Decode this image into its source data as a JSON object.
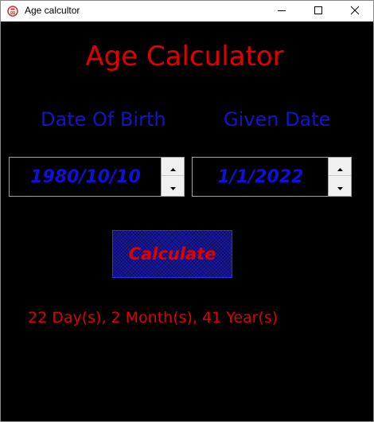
{
  "window": {
    "title": "Age calcultor",
    "icon": "calculator-app-icon",
    "controls": [
      "minimize-icon",
      "maximize-icon",
      "close-icon"
    ]
  },
  "app": {
    "heading": "Age Calculator",
    "dob_label": "Date Of Birth",
    "given_label": "Given Date",
    "dob_value": "1980/10/10",
    "given_value": "1/1/2022",
    "calculate_label": "Calculate",
    "result": "22 Day(s), 2 Month(s), 41 Year(s)"
  },
  "colors": {
    "background": "#000000",
    "heading": "#e00000",
    "labels": "#1414c8",
    "values": "#1010d8",
    "button_face": "#1a1aa8",
    "button_text": "#e00000",
    "result": "#e00000"
  }
}
